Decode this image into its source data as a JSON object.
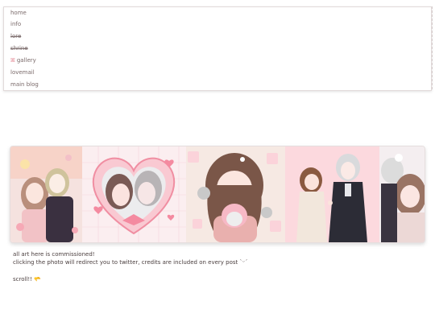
{
  "nav": {
    "items": [
      {
        "label": "home",
        "strike": false
      },
      {
        "label": "info",
        "strike": false
      },
      {
        "label": "lore",
        "strike": true
      },
      {
        "label": "shrine",
        "strike": true
      },
      {
        "label": "gallery",
        "strike": false,
        "icon": "ribbon-icon"
      },
      {
        "label": "lovemail",
        "strike": false
      },
      {
        "label": "main blog",
        "strike": false
      }
    ]
  },
  "gallery": {
    "images": [
      {
        "name": "art-couple-pastel",
        "accent": "#f3cbd0"
      },
      {
        "name": "art-heart-frame",
        "accent": "#f7c6cf"
      },
      {
        "name": "art-girl-plush",
        "accent": "#f6dde2"
      },
      {
        "name": "art-couple-pink-bg",
        "accent": "#fbd7dd"
      },
      {
        "name": "art-partial-couple",
        "accent": "#f1e6ea"
      }
    ]
  },
  "captions": {
    "line1": "all art here is commissioned!",
    "line2": "clicking the photo will redirect you to twitter, credits are included on every post `ᵕ´",
    "line3": "scroll!! 🫳"
  },
  "colors": {
    "accent_pink": "#e07a88",
    "text": "#4a3e3e",
    "nav_text": "#7a6a6a"
  }
}
